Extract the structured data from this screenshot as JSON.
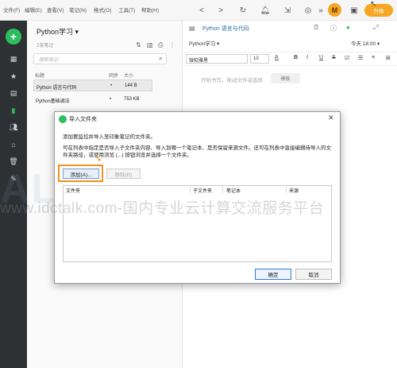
{
  "menu": [
    "文件(F)",
    "编辑(E)",
    "查看(V)",
    "笔记(N)",
    "格式(O)",
    "工具(T)",
    "帮助(H)"
  ],
  "toolbar": {
    "back": "<",
    "forward": ">",
    "avatar_letter": "M",
    "upgrade_label": "升级"
  },
  "notebook": {
    "title": "Python学习 ▾",
    "count": "2条笔记",
    "search_placeholder": "搜索笔记",
    "columns": [
      "标题",
      "同步",
      "大小"
    ],
    "rows": [
      {
        "title": "Python 语言与代码",
        "sync": "•",
        "size": "144 B"
      },
      {
        "title": "Python基础调法",
        "sync": "•",
        "size": "753 KB"
      }
    ]
  },
  "editor": {
    "note_title": "Python 语言与代码",
    "notebook_select": "Python学习 ▾",
    "date": "今天 18:00 ▾",
    "font": "微软雅黑",
    "size": "10",
    "format_buttons": [
      "A",
      "B",
      "I",
      "U",
      "S"
    ],
    "placeholder": "开始书写，拖动文件或选择",
    "template_label": "模板"
  },
  "dialog": {
    "title": "导入文件夹",
    "close": "✕",
    "desc1": "添加要监控并导入至印象笔记的文件夹。",
    "desc2": "可在列表中指定是否导入子文件夹内容、导入到哪一个笔记本、是否保留来源文件。还可在列表中直接编辑待导入的文件夹路径，或使用浏览 (...) 按钮浏览并选择一个文件夹。",
    "add_button": "添加(A)...",
    "remove_button": "移除(R)",
    "table_headers": [
      "文件夹",
      "子文件夹",
      "笔记本",
      "来源"
    ],
    "ok_button": "确定",
    "cancel_button": "取消"
  },
  "watermark": {
    "big": "ALK 云计",
    "url": "www.idctalk.com-国内专业云计算交流服务平台"
  },
  "colors": {
    "accent_green": "#2dbe60",
    "highlight_orange": "#f0901e",
    "rail_dark": "#2e3133"
  }
}
